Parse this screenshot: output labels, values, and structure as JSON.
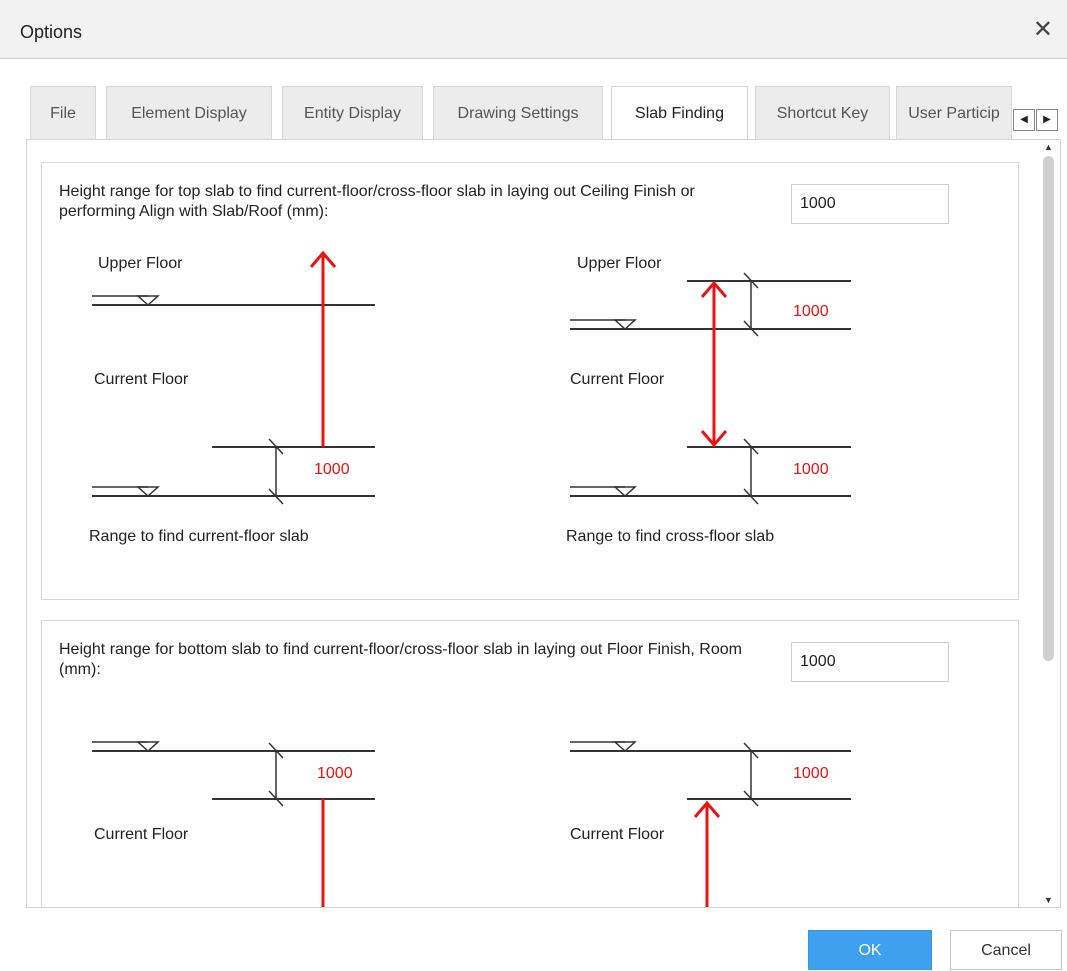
{
  "window": {
    "title": "Options",
    "close_glyph": "✕"
  },
  "tabs": [
    {
      "label": "File",
      "active": false
    },
    {
      "label": "Element Display",
      "active": false
    },
    {
      "label": "Entity Display",
      "active": false
    },
    {
      "label": "Drawing Settings",
      "active": false
    },
    {
      "label": "Slab Finding",
      "active": true
    },
    {
      "label": "Shortcut Key",
      "active": false
    },
    {
      "label": "User Particip",
      "active": false
    }
  ],
  "tab_scroll": {
    "left_glyph": "◀",
    "right_glyph": "▶"
  },
  "top_slab": {
    "description": "Height range for top slab to find current-floor/cross-floor slab in laying out Ceiling Finish or performing Align with Slab/Roof (mm):",
    "value": "1000",
    "left_diagram": {
      "upper_floor": "Upper Floor",
      "current_floor": "Current Floor",
      "dimension": "1000",
      "caption": "Range to find current-floor slab"
    },
    "right_diagram": {
      "upper_floor": "Upper Floor",
      "current_floor": "Current Floor",
      "dimension_top": "1000",
      "dimension_bottom": "1000",
      "caption": "Range to find cross-floor slab"
    }
  },
  "bottom_slab": {
    "description": "Height range for bottom slab to find current-floor/cross-floor slab in laying out Floor Finish, Room (mm):",
    "value": "1000",
    "left_diagram": {
      "dimension": "1000",
      "current_floor": "Current Floor"
    },
    "right_diagram": {
      "dimension": "1000",
      "current_floor": "Current Floor"
    }
  },
  "scrollbar": {
    "up_glyph": "▲",
    "down_glyph": "▼"
  },
  "buttons": {
    "ok": "OK",
    "cancel": "Cancel"
  },
  "colors": {
    "dimension_red": "#ee1111",
    "ok_blue": "#3fa0f0"
  }
}
